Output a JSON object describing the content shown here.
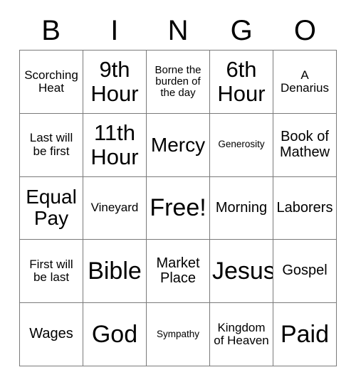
{
  "card": {
    "header_letters": [
      "B",
      "I",
      "N",
      "G",
      "O"
    ],
    "grid_line_color": "#7a7a7a",
    "text_color": "#000000",
    "background_color": "#ffffff",
    "rows": 5,
    "columns": 5
  },
  "cells": [
    {
      "text": "Scorching Heat",
      "size": "sm"
    },
    {
      "text": "9th Hour",
      "size": "xl"
    },
    {
      "text": "Borne the burden of the day",
      "size": "xs"
    },
    {
      "text": "6th Hour",
      "size": "xl"
    },
    {
      "text": "A Denarius",
      "size": "sm"
    },
    {
      "text": "Last will be first",
      "size": "sm"
    },
    {
      "text": "11th Hour",
      "size": "xl"
    },
    {
      "text": "Mercy",
      "size": "lg"
    },
    {
      "text": "Generosity",
      "size": "xxs"
    },
    {
      "text": "Book of Mathew",
      "size": "md"
    },
    {
      "text": "Equal Pay",
      "size": "lg"
    },
    {
      "text": "Vineyard",
      "size": "sm"
    },
    {
      "text": "Free!",
      "size": "xxl"
    },
    {
      "text": "Morning",
      "size": "md"
    },
    {
      "text": "Laborers",
      "size": "md"
    },
    {
      "text": "First will be last",
      "size": "sm"
    },
    {
      "text": "Bible",
      "size": "xxl"
    },
    {
      "text": "Market Place",
      "size": "md"
    },
    {
      "text": "Jesus",
      "size": "xxl"
    },
    {
      "text": "Gospel",
      "size": "md"
    },
    {
      "text": "Wages",
      "size": "md"
    },
    {
      "text": "God",
      "size": "xxl"
    },
    {
      "text": "Sympathy",
      "size": "xxs"
    },
    {
      "text": "Kingdom of Heaven",
      "size": "sm"
    },
    {
      "text": "Paid",
      "size": "xxl"
    }
  ]
}
